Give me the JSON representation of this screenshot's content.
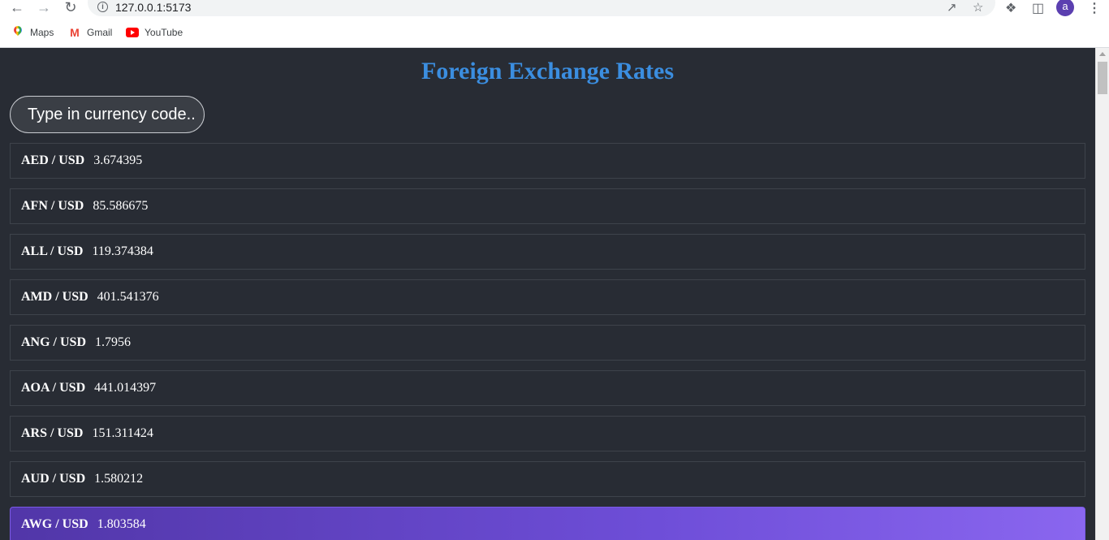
{
  "browser": {
    "url": "127.0.0.1:5173",
    "avatar_letter": "a",
    "bookmarks": [
      {
        "label": "Maps",
        "icon": "maps-icon"
      },
      {
        "label": "Gmail",
        "icon": "gmail-icon"
      },
      {
        "label": "YouTube",
        "icon": "youtube-icon"
      }
    ]
  },
  "page": {
    "title": "Foreign Exchange Rates",
    "search_placeholder": "Type in currency code..",
    "title_color": "#3b8ee0",
    "background_color": "#282c34",
    "rates": [
      {
        "pair": "AED / USD",
        "value": "3.674395"
      },
      {
        "pair": "AFN / USD",
        "value": "85.586675"
      },
      {
        "pair": "ALL / USD",
        "value": "119.374384"
      },
      {
        "pair": "AMD / USD",
        "value": "401.541376"
      },
      {
        "pair": "ANG / USD",
        "value": "1.7956"
      },
      {
        "pair": "AOA / USD",
        "value": "441.014397"
      },
      {
        "pair": "ARS / USD",
        "value": "151.311424"
      },
      {
        "pair": "AUD / USD",
        "value": "1.580212"
      },
      {
        "pair": "AWG / USD",
        "value": "1.803584"
      }
    ]
  }
}
